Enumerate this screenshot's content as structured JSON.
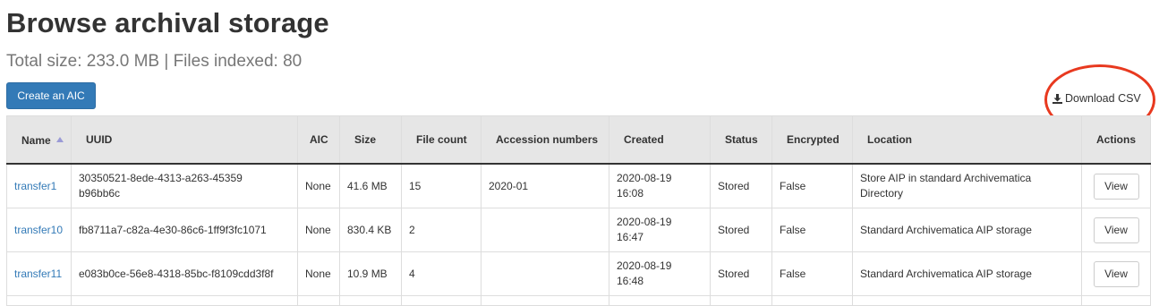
{
  "page": {
    "title": "Browse archival storage",
    "summary": "Total size: 233.0 MB | Files indexed: 80"
  },
  "toolbar": {
    "create_aic_label": "Create an AIC",
    "download_csv_label": "Download CSV",
    "download_icon": "download-icon"
  },
  "colors": {
    "primary": "#337ab7",
    "link": "#337ab7",
    "header_bg": "#e6e6e6",
    "highlight": "#e8391f"
  },
  "table": {
    "columns": [
      {
        "label": "Name",
        "sorted": "ascending"
      },
      {
        "label": "UUID"
      },
      {
        "label": "AIC"
      },
      {
        "label": "Size"
      },
      {
        "label": "File count"
      },
      {
        "label": "Accession numbers"
      },
      {
        "label": "Created"
      },
      {
        "label": "Status"
      },
      {
        "label": "Encrypted"
      },
      {
        "label": "Location"
      },
      {
        "label": "Actions"
      }
    ],
    "rows": [
      {
        "name": "transfer1",
        "uuid": "30350521-8ede-4313-a263-45359b96bb6c",
        "aic": "None",
        "size": "41.6 MB",
        "file_count": "15",
        "accession": "2020-01",
        "created": "2020-08-19 16:08",
        "status": "Stored",
        "encrypted": "False",
        "location": "Store AIP in standard Archivematica Directory",
        "action": "View"
      },
      {
        "name": "transfer10",
        "uuid": "fb8711a7-c82a-4e30-86c6-1ff9f3fc1071",
        "aic": "None",
        "size": "830.4 KB",
        "file_count": "2",
        "accession": "",
        "created": "2020-08-19 16:47",
        "status": "Stored",
        "encrypted": "False",
        "location": "Standard Archivematica AIP storage",
        "action": "View"
      },
      {
        "name": "transfer11",
        "uuid": "e083b0ce-56e8-4318-85bc-f8109cdd3f8f",
        "aic": "None",
        "size": "10.9 MB",
        "file_count": "4",
        "accession": "",
        "created": "2020-08-19 16:48",
        "status": "Stored",
        "encrypted": "False",
        "location": "Standard Archivematica AIP storage",
        "action": "View"
      }
    ]
  }
}
